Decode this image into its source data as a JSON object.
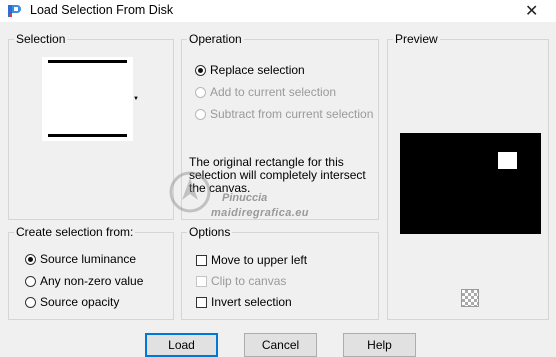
{
  "window": {
    "title": "Load Selection From Disk",
    "close_glyph": "✕",
    "icon": "paintshop-pro-icon"
  },
  "selection": {
    "legend": "Selection"
  },
  "operation": {
    "legend": "Operation",
    "options": [
      "Replace selection",
      "Add to current selection",
      "Subtract from current selection"
    ],
    "selected": "Replace selection",
    "info_lines": [
      "The original rectangle for this",
      "selection will completely intersect",
      "the canvas."
    ]
  },
  "preview": {
    "legend": "Preview",
    "mask_color": "#000000",
    "selection_color": "#ffffff"
  },
  "create_from": {
    "legend": "Create selection from:",
    "options": [
      "Source luminance",
      "Any non-zero value",
      "Source opacity"
    ],
    "selected": "Source luminance"
  },
  "options": {
    "legend": "Options",
    "items": [
      {
        "label": "Move to upper left",
        "checked": false,
        "enabled": true
      },
      {
        "label": "Clip to canvas",
        "checked": false,
        "enabled": false
      },
      {
        "label": "Invert selection",
        "checked": false,
        "enabled": true
      }
    ]
  },
  "watermark": {
    "line1": "Pinuccia",
    "line2": "maidiregrafica.eu"
  },
  "buttons": {
    "load": "Load",
    "cancel": "Cancel",
    "help": "Help"
  },
  "colors": {
    "accent": "#0078d7",
    "dialog_bg": "#f0f0f0",
    "button_bg": "#e1e1e1"
  }
}
